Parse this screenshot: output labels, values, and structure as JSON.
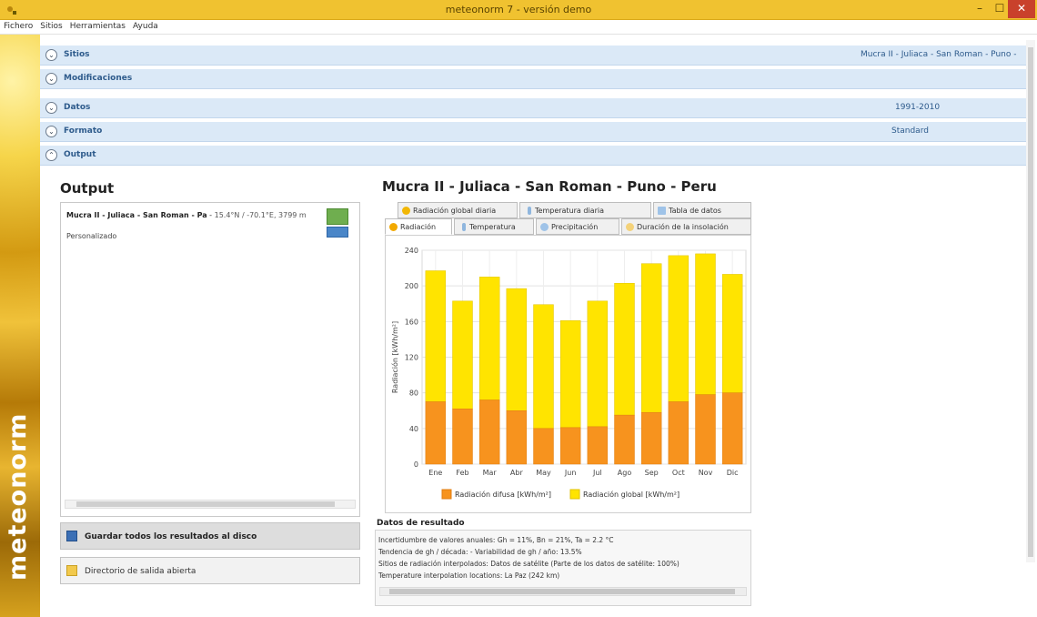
{
  "window": {
    "title": "meteonorm 7 - versión demo",
    "minimize": "–",
    "maximize": "☐",
    "close": "✕"
  },
  "menu": [
    "Fichero",
    "Sitios",
    "Herramientas",
    "Ayuda"
  ],
  "brand": "meteonorm",
  "sections": [
    {
      "label": "Sitios",
      "value": "Mucra II - Juliaca - San Roman - Puno -",
      "chevron": "down"
    },
    {
      "label": "Modificaciones",
      "value": "",
      "chevron": "down"
    },
    {
      "label": "Datos",
      "value": "1991-2010",
      "chevron": "down"
    },
    {
      "label": "Formato",
      "value": "Standard",
      "chevron": "down"
    },
    {
      "label": "Output",
      "value": "",
      "chevron": "up"
    }
  ],
  "output_panel": {
    "heading": "Output",
    "site_name": "Mucra II - Juliaca - San Roman - Pa",
    "site_coords": "15.4°N / -70.1°E, 3799 m",
    "format": "Personalizado",
    "save_all": "Guardar todos los resultados al disco",
    "open_dir": "Directorio de salida abierta"
  },
  "chart_panel": {
    "heading": "Mucra II - Juliaca - San Roman - Puno - Peru",
    "tabs_row1": [
      "Radiación global diaria",
      "Temperatura diaria",
      "Tabla de datos"
    ],
    "tabs_row2": [
      "Radiación",
      "Temperatura",
      "Precipitación",
      "Duración de la insolación"
    ],
    "active_tab": "Radiación"
  },
  "chart_data": {
    "type": "bar",
    "stacked": true,
    "categories": [
      "Ene",
      "Feb",
      "Mar",
      "Abr",
      "May",
      "Jun",
      "Jul",
      "Ago",
      "Sep",
      "Oct",
      "Nov",
      "Dic"
    ],
    "series": [
      {
        "name": "Radiación difusa [kWh/m²]",
        "color": "#f7931e",
        "values": [
          70,
          62,
          72,
          60,
          40,
          41,
          42,
          55,
          58,
          70,
          78,
          80
        ]
      },
      {
        "name": "Radiación global [kWh/m²]",
        "color": "#ffe400",
        "values": [
          217,
          183,
          210,
          197,
          179,
          161,
          183,
          203,
          225,
          234,
          236,
          213
        ]
      }
    ],
    "ylabel": "Radiación [kWh/m²]",
    "ylim": [
      0,
      240
    ],
    "yticks": [
      0,
      40,
      80,
      120,
      160,
      200,
      240
    ],
    "grid": true,
    "legend_position": "bottom"
  },
  "results": {
    "heading": "Datos de resultado",
    "lines": [
      "Incertidumbre de valores anuales: Gh = 11%, Bn = 21%, Ta = 2.2 °C",
      "Tendencia de gh / década: -   Variabilidad de gh / año: 13.5%",
      "Sitios de radiación interpolados: Datos de satélite  (Parte de los datos de satélite: 100%)",
      "Temperature interpolation locations: La Paz (242 km)"
    ]
  }
}
